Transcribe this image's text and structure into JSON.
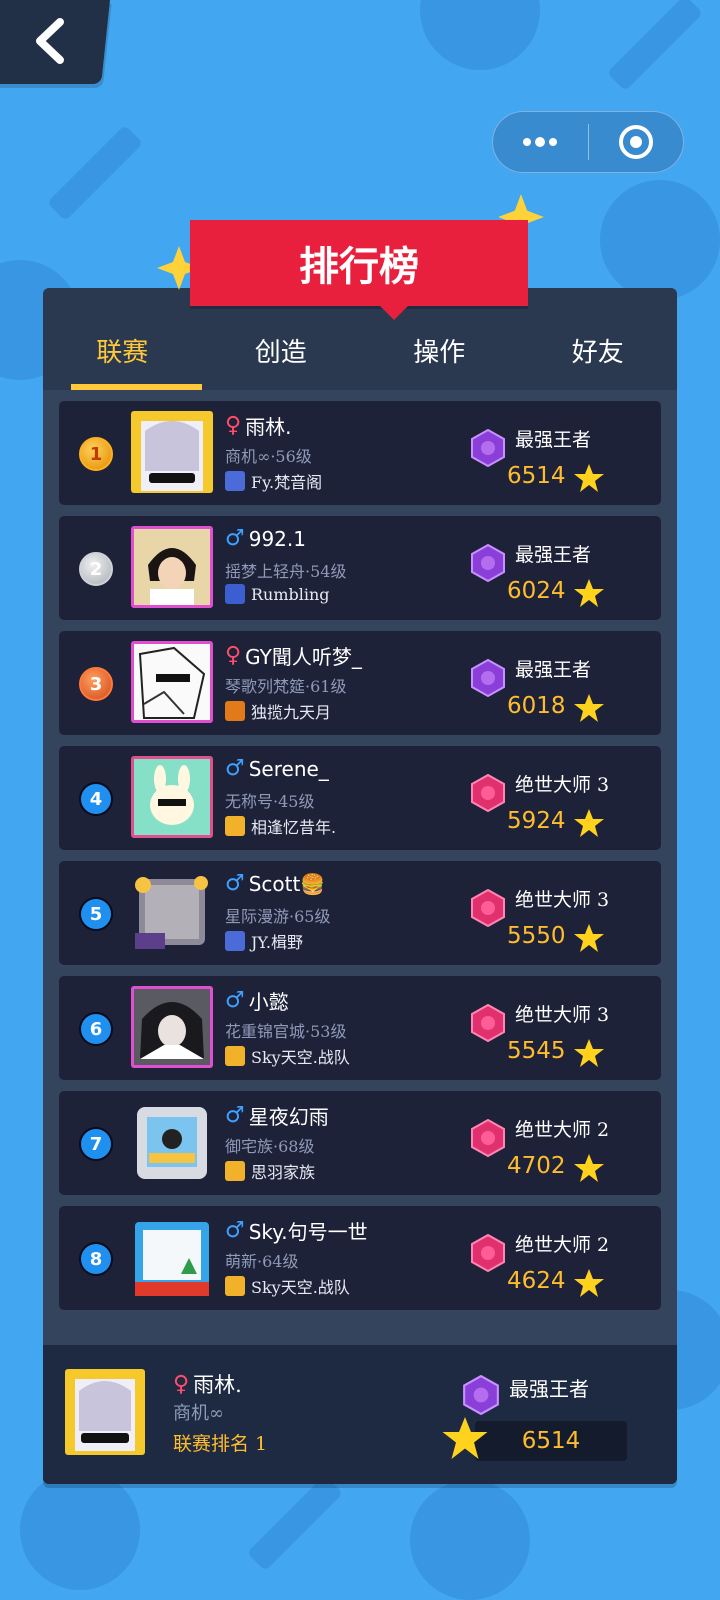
{
  "header": {
    "back_label": "",
    "more_icon": "more-dots-icon",
    "close_icon": "target-close-icon"
  },
  "title": "排行榜",
  "tabs": [
    {
      "label": "联赛",
      "active": true
    },
    {
      "label": "创造",
      "active": false
    },
    {
      "label": "操作",
      "active": false
    },
    {
      "label": "好友",
      "active": false
    }
  ],
  "rows": [
    {
      "rank": "1",
      "gender": "♀",
      "name": "雨林.",
      "sub": "商机∞·56级",
      "team": "Fy.梵音阁",
      "tier": "最强王者",
      "score": "6514"
    },
    {
      "rank": "2",
      "gender": "♂",
      "name": "992.1",
      "sub": "摇梦上轻舟·54级",
      "team": "Rumbling",
      "tier": "最强王者",
      "score": "6024"
    },
    {
      "rank": "3",
      "gender": "♀",
      "name": "GY聞人听梦_",
      "sub": "琴歌列梵筵·61级",
      "team": "独揽九天月",
      "tier": "最强王者",
      "score": "6018"
    },
    {
      "rank": "4",
      "gender": "♂",
      "name": "Serene_",
      "sub": "无称号·45级",
      "team": "相逢忆昔年.",
      "tier": "绝世大师 3",
      "score": "5924"
    },
    {
      "rank": "5",
      "gender": "♂",
      "name": "Scott🍔",
      "sub": "星际漫游·65级",
      "team": "JY.楫野",
      "tier": "绝世大师 3",
      "score": "5550"
    },
    {
      "rank": "6",
      "gender": "♂",
      "name": "小懿",
      "sub": "花重锦官城·53级",
      "team": "Sky天空.战队",
      "tier": "绝世大师 3",
      "score": "5545"
    },
    {
      "rank": "7",
      "gender": "♂",
      "name": "星夜幻雨",
      "sub": "御宅族·68级",
      "team": "思羽家族",
      "tier": "绝世大师 2",
      "score": "4702"
    },
    {
      "rank": "8",
      "gender": "♂",
      "name": "Sky.句号一世",
      "sub": "萌新·64级",
      "team": "Sky天空.战队",
      "tier": "绝世大师 2",
      "score": "4624"
    }
  ],
  "me": {
    "gender": "♀",
    "name": "雨林.",
    "sub": "商机∞",
    "rank_text": "联赛排名 1",
    "tier": "最强王者",
    "score": "6514"
  },
  "colors": {
    "accent": "#ffc93a",
    "banner": "#e8203e",
    "score": "#ffbd2e",
    "panel": "#2a3850",
    "row": "#1e2238"
  }
}
